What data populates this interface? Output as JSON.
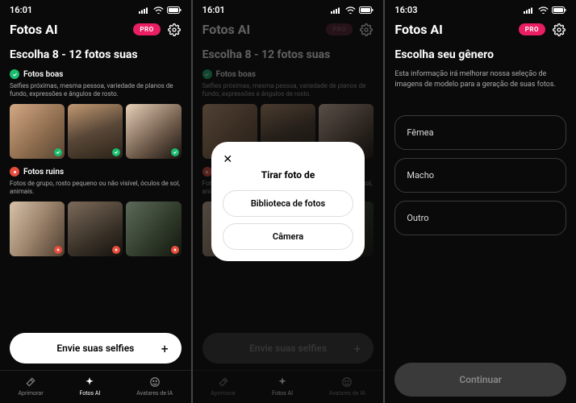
{
  "statusBar": {
    "time1": "16:01",
    "time2": "16:01",
    "time3": "16:03"
  },
  "header": {
    "title": "Fotos AI",
    "proLabel": "PRO"
  },
  "screen1": {
    "subtitle": "Escolha 8 - 12 fotos suas",
    "goodLabel": "Fotos boas",
    "goodDesc": "Selfies próximas, mesma pessoa, variedade de planos de fundo, expressões e ângulos de rosto.",
    "badLabel": "Fotos ruins",
    "badDesc": "Fotos de grupo, rosto pequeno ou não visível, óculos de sol, animais.",
    "cta": "Envie suas selfies"
  },
  "modal": {
    "title": "Tirar foto de",
    "option1": "Biblioteca de fotos",
    "option2": "Câmera"
  },
  "screen3": {
    "subtitle": "Escolha seu gênero",
    "desc": "Esta informação irá melhorar nossa seleção de imagens de modelo para a geração de suas fotos.",
    "opt1": "Fêmea",
    "opt2": "Macho",
    "opt3": "Outro",
    "continue": "Continuar"
  },
  "tabs": {
    "t1": "Aprimorar",
    "t2": "Fotos AI",
    "t3": "Avatares de IA"
  }
}
